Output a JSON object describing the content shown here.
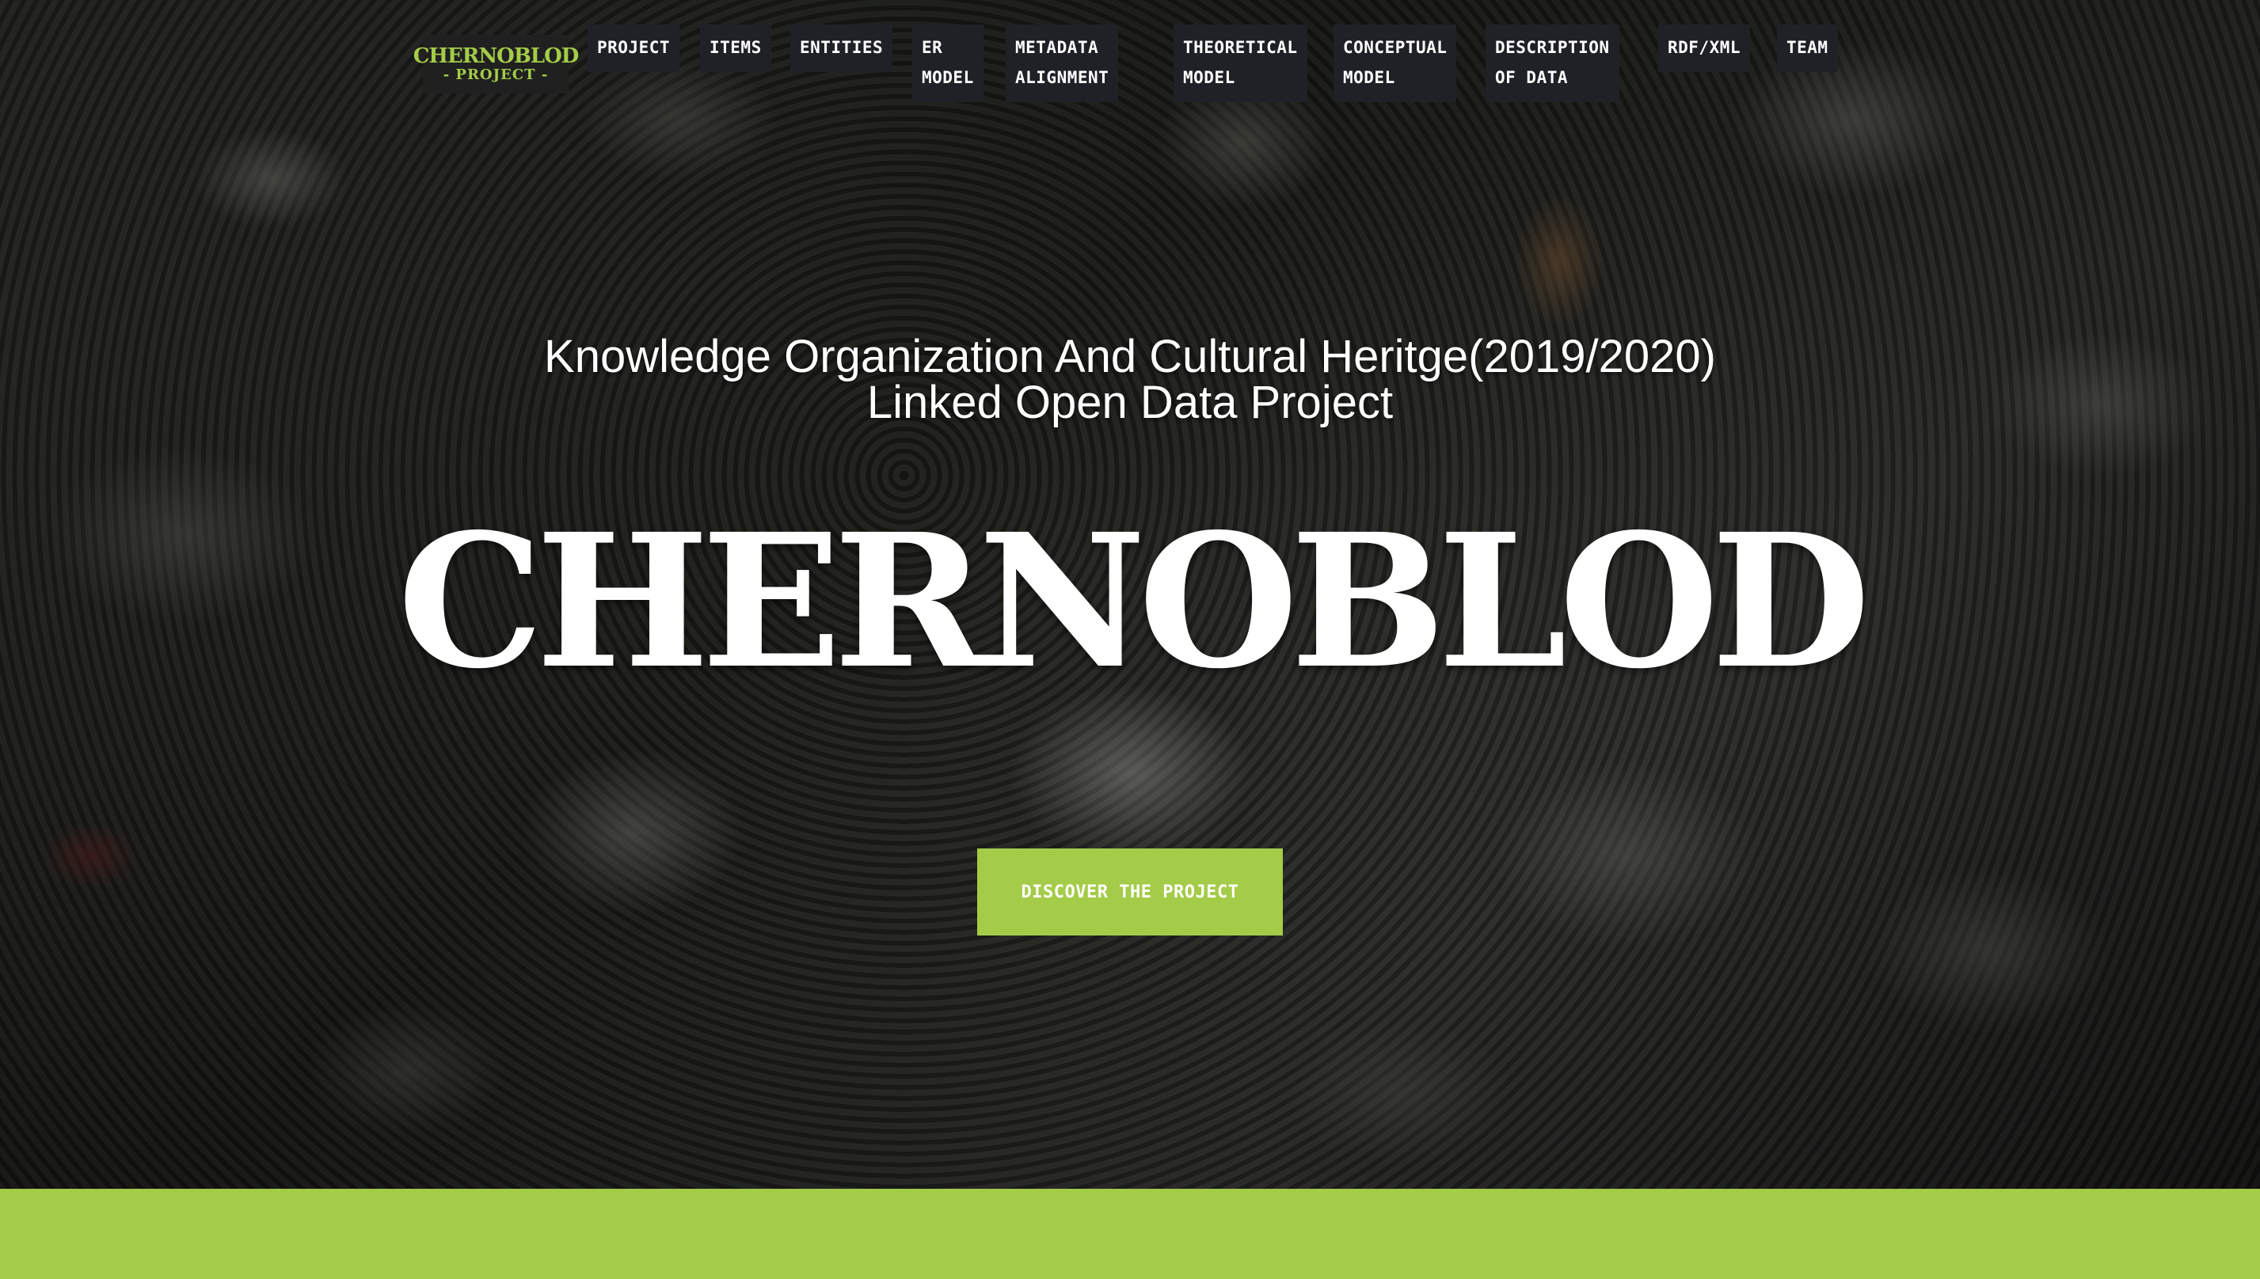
{
  "logo": {
    "line1": "CHERNOBLOD",
    "line2": "- PROJECT -"
  },
  "nav": {
    "items": [
      {
        "line1": "Project",
        "line2": ""
      },
      {
        "line1": "Items",
        "line2": ""
      },
      {
        "line1": "Entities",
        "line2": ""
      },
      {
        "line1": "ER",
        "line2": "Model"
      },
      {
        "line1": "Metadata",
        "line2": "Alignment"
      },
      {
        "line1": "Theoretical",
        "line2": "Model"
      },
      {
        "line1": "Conceptual",
        "line2": "Model"
      },
      {
        "line1": "Description",
        "line2": "of Data"
      },
      {
        "line1": "RDF/XML",
        "line2": ""
      },
      {
        "line1": "Team",
        "line2": ""
      }
    ]
  },
  "hero": {
    "subtitle_line1": "Knowledge Organization And Cultural Heritge(2019/2020)",
    "subtitle_line2": "Linked Open Data Project",
    "title": "CHERNOBLOD",
    "cta_label": "Discover the project"
  },
  "colors": {
    "accent": "#a4cc48",
    "nav_bg": "#1f2126"
  }
}
